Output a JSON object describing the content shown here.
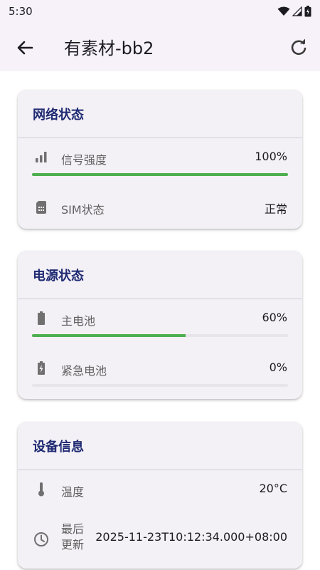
{
  "status_bar": {
    "time": "5:30"
  },
  "app_bar": {
    "title": "有素材-bb2"
  },
  "network": {
    "title": "网络状态",
    "signal_label": "信号强度",
    "signal_value": "100%",
    "signal_level": 1.0,
    "sim_label": "SIM状态",
    "sim_value": "正常"
  },
  "power": {
    "title": "电源状态",
    "main_label": "主电池",
    "main_value": "60%",
    "main_level": 0.6,
    "emergency_label": "紧急电池",
    "emergency_value": "0%",
    "emergency_level": 0.0
  },
  "device": {
    "title": "设备信息",
    "temp_label": "温度",
    "temp_value": "20°C",
    "updated_label_line1": "最后",
    "updated_label_line2": "更新",
    "updated_value": "2025-11-23T10:12:34.000+08:00"
  },
  "colors": {
    "accent": "#4caf50",
    "title": "#1f2a72",
    "card_bg": "#f3f0f6",
    "appbar_bg": "#f7f2fa"
  },
  "icons": [
    "wifi-icon",
    "cellular-icon",
    "battery-icon",
    "back-arrow-icon",
    "refresh-icon",
    "signal-bars-icon",
    "sim-card-icon",
    "battery-full-icon",
    "battery-charging-icon",
    "thermometer-icon",
    "clock-icon"
  ]
}
